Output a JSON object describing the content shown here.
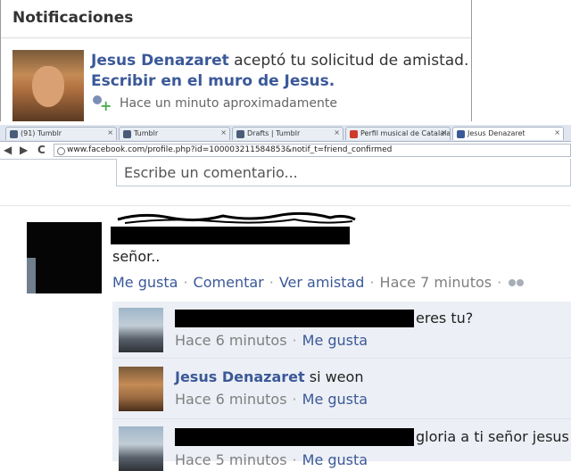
{
  "notification": {
    "header": "Notificaciones",
    "name": "Jesus Denazaret",
    "action": " aceptó tu solicitud de amistad.",
    "link": "Escribir en el muro de Jesus.",
    "time": "Hace un minuto aproximadamente"
  },
  "browser": {
    "tabs": [
      {
        "label": "(91) Tumblr",
        "icon": "tumblr-icon"
      },
      {
        "label": "Tumblr",
        "icon": "tumblr-icon"
      },
      {
        "label": "Drafts | Tumblr",
        "icon": "tumblr-icon"
      },
      {
        "label": "Perfil musical de Catalalala- ...",
        "icon": "music-icon"
      },
      {
        "label": "Jesus Denazaret",
        "icon": "facebook-icon"
      }
    ],
    "back": "◀",
    "forward": "▶",
    "reload": "C",
    "url": "www.facebook.com/profile.php?id=100003211584853&notif_t=friend_confirmed"
  },
  "comment_box": {
    "placeholder": "Escribe un comentario..."
  },
  "post": {
    "text": "señor..",
    "actions": {
      "like": "Me gusta",
      "comment": "Comentar",
      "friendship": "Ver amistad",
      "time": "Hace 7 minutos"
    }
  },
  "comments": [
    {
      "name": "",
      "text": "eres tu?",
      "time": "Hace 6 minutos",
      "like": "Me gusta"
    },
    {
      "name": "Jesus Denazaret",
      "text": " si weon",
      "time": "Hace 6 minutos",
      "like": "Me gusta"
    },
    {
      "name": "",
      "text": "gloria a ti señor jesus",
      "time": "Hace 5 minutos",
      "like": "Me gusta"
    }
  ],
  "colors": {
    "link": "#3b5998",
    "muted": "#7f7f7f",
    "comment_bg": "#eceff5"
  }
}
